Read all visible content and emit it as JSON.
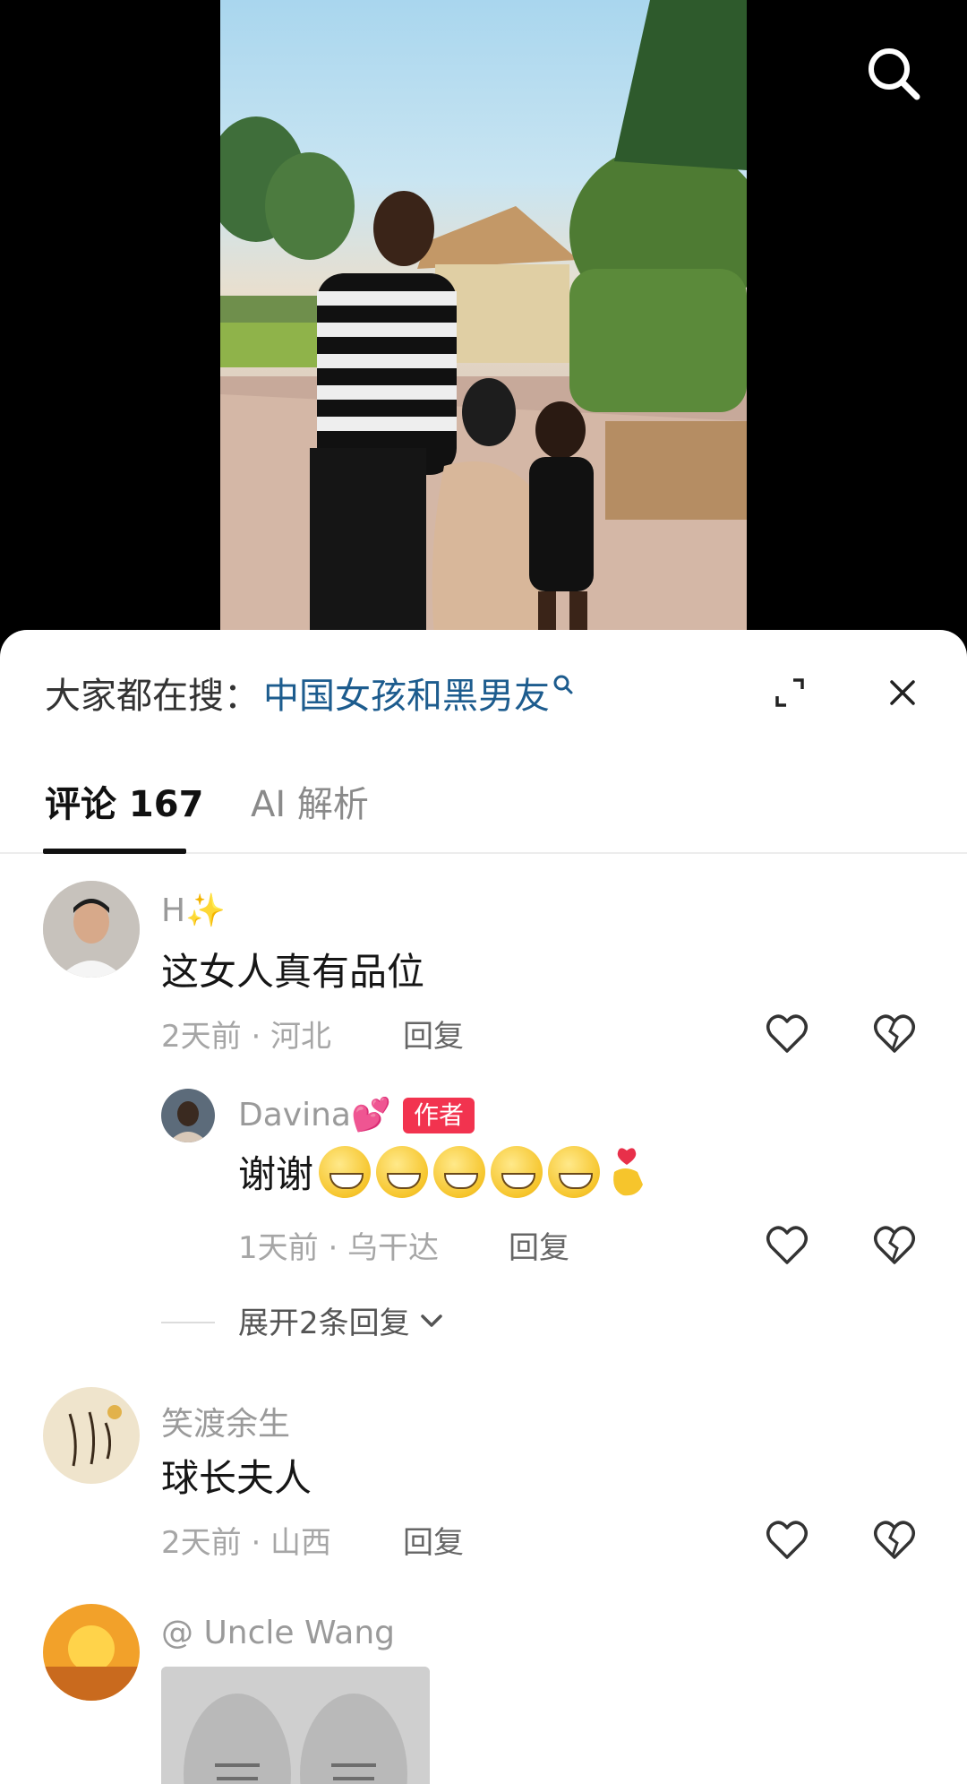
{
  "search": {
    "icon": "search-icon"
  },
  "hot_search": {
    "prefix": "大家都在搜：",
    "query": "中国女孩和黑男友",
    "icon": "search-small-icon"
  },
  "tabs": [
    {
      "label": "评论 167",
      "active": true
    },
    {
      "label": "AI 解析",
      "active": false
    }
  ],
  "comments": [
    {
      "username": "H✨",
      "text": "这女人真有品位",
      "time": "2天前 · 河北",
      "reply_label": "回复",
      "replies": [
        {
          "username": "Davina💕",
          "badge": "作者",
          "text": "谢谢",
          "emoji_count": 5,
          "time": "1天前 · 乌干达",
          "reply_label": "回复"
        }
      ],
      "expand_label": "展开2条回复"
    },
    {
      "username": "笑渡余生",
      "text": "球长夫人",
      "time": "2天前 · 山西",
      "reply_label": "回复"
    },
    {
      "username": "@ Uncle Wang"
    }
  ],
  "colors": {
    "accent_link": "#1d5c8e",
    "badge": "#f2334f",
    "text": "#161616",
    "muted": "#a6a6a6"
  }
}
